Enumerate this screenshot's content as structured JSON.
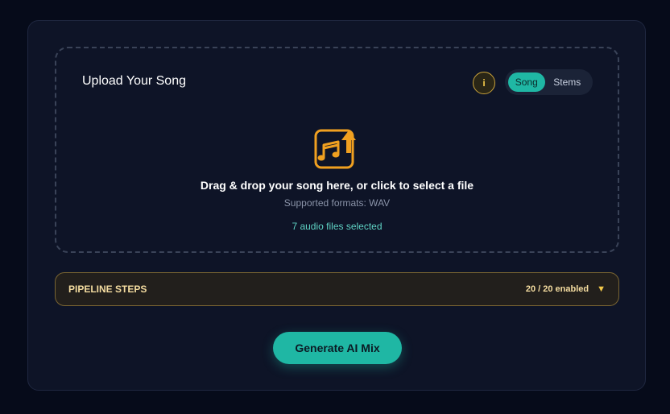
{
  "colors": {
    "background": "#060b1a",
    "card": "#0e1427",
    "accent_teal": "#1fb7a4",
    "accent_gold": "#f3c94a",
    "upload_icon": "#f0a020"
  },
  "upload": {
    "title": "Upload Your Song",
    "info_label": "i",
    "mode_toggle": {
      "options": [
        "Song",
        "Stems"
      ],
      "selected": "Song"
    },
    "icon": "music-upload-icon",
    "instruction": "Drag & drop your song here, or click to select a file",
    "supported_formats": "Supported formats: WAV",
    "selection_status": "7 audio files selected"
  },
  "pipeline": {
    "label": "PIPELINE STEPS",
    "count": "20 / 20 enabled",
    "caret": "▼"
  },
  "actions": {
    "generate_label": "Generate AI Mix"
  }
}
